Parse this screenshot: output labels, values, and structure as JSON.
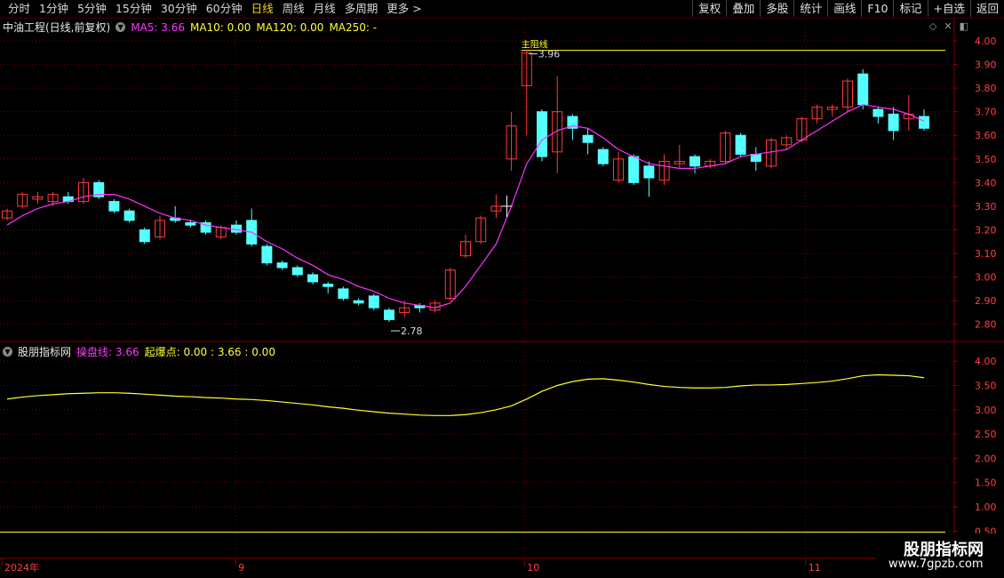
{
  "toolbar": {
    "periods": [
      "分时",
      "1分钟",
      "5分钟",
      "15分钟",
      "30分钟",
      "60分钟",
      "日线",
      "周线",
      "月线",
      "多周期",
      "更多 >"
    ],
    "active_period": "日线",
    "actions": [
      "复权",
      "叠加",
      "多股",
      "统计",
      "画线",
      "F10",
      "标记",
      "+自选",
      "返回"
    ]
  },
  "main_panel": {
    "stock_title": "中油工程(日线,前复权)",
    "ma5_label": "MA5: 3.66",
    "ma10_label": "MA10: 0.00",
    "ma120_label": "MA120: 0.00",
    "ma250_label": "MA250: -",
    "high_annotation": "3.96",
    "low_annotation": "2.78",
    "resistance_label": "主阻线",
    "y_ticks": [
      "4.00",
      "3.90",
      "3.80",
      "3.70",
      "3.60",
      "3.50",
      "3.40",
      "3.30",
      "3.20",
      "3.10",
      "3.00",
      "2.90",
      "2.80"
    ]
  },
  "indicator_panel": {
    "name": "股朋指标网",
    "line1_label": "操盘线: 3.66",
    "line2_label": "起爆点: 0.00 : 3.66 : 0.00",
    "y_ticks": [
      "4.00",
      "3.50",
      "3.00",
      "2.50",
      "2.00",
      "1.50",
      "1.00",
      "0.50"
    ]
  },
  "x_axis": {
    "labels": [
      "2024年",
      "9",
      "10",
      "11"
    ]
  },
  "colors": {
    "up": "#ff3b3b",
    "down": "#54ffff",
    "ma5": "#ff33ff",
    "indicator": "#ffff33",
    "grid": "#7a0000",
    "axis_text": "#ff4040"
  },
  "watermark": {
    "title": "股朋指标网",
    "url": "www.7gpzb.com"
  },
  "chart_data": {
    "type": "candlestick",
    "title": "中油工程(日线,前复权)",
    "ylim": [
      2.75,
      4.03
    ],
    "candles": [
      [
        3.25,
        3.29,
        3.24,
        3.28
      ],
      [
        3.3,
        3.36,
        3.29,
        3.35
      ],
      [
        3.33,
        3.36,
        3.31,
        3.34
      ],
      [
        3.32,
        3.36,
        3.3,
        3.35
      ],
      [
        3.34,
        3.36,
        3.31,
        3.32
      ],
      [
        3.32,
        3.42,
        3.31,
        3.4
      ],
      [
        3.4,
        3.41,
        3.33,
        3.34
      ],
      [
        3.32,
        3.33,
        3.27,
        3.28
      ],
      [
        3.28,
        3.29,
        3.23,
        3.24
      ],
      [
        3.2,
        3.21,
        3.14,
        3.15
      ],
      [
        3.17,
        3.26,
        3.16,
        3.24
      ],
      [
        3.25,
        3.3,
        3.23,
        3.24
      ],
      [
        3.23,
        3.24,
        3.21,
        3.22
      ],
      [
        3.23,
        3.24,
        3.18,
        3.19
      ],
      [
        3.17,
        3.22,
        3.16,
        3.21
      ],
      [
        3.22,
        3.24,
        3.18,
        3.19
      ],
      [
        3.24,
        3.29,
        3.13,
        3.14
      ],
      [
        3.13,
        3.14,
        3.05,
        3.06
      ],
      [
        3.06,
        3.07,
        3.03,
        3.04
      ],
      [
        3.04,
        3.05,
        3.0,
        3.01
      ],
      [
        3.01,
        3.02,
        2.97,
        2.98
      ],
      [
        2.97,
        2.98,
        2.93,
        2.96
      ],
      [
        2.95,
        2.96,
        2.9,
        2.91
      ],
      [
        2.9,
        2.91,
        2.88,
        2.89
      ],
      [
        2.92,
        2.93,
        2.86,
        2.87
      ],
      [
        2.86,
        2.87,
        2.81,
        2.82
      ],
      [
        2.85,
        2.9,
        2.83,
        2.87
      ],
      [
        2.88,
        2.89,
        2.85,
        2.87
      ],
      [
        2.86,
        2.9,
        2.85,
        2.89
      ],
      [
        2.91,
        3.04,
        2.9,
        3.03
      ],
      [
        3.09,
        3.18,
        3.08,
        3.15
      ],
      [
        3.15,
        3.26,
        3.14,
        3.25
      ],
      [
        3.28,
        3.35,
        3.25,
        3.3
      ],
      [
        3.5,
        3.7,
        3.45,
        3.64
      ],
      [
        3.81,
        3.96,
        3.6,
        3.95
      ],
      [
        3.7,
        3.71,
        3.49,
        3.51
      ],
      [
        3.53,
        3.85,
        3.44,
        3.7
      ],
      [
        3.68,
        3.69,
        3.58,
        3.63
      ],
      [
        3.6,
        3.63,
        3.52,
        3.57
      ],
      [
        3.54,
        3.55,
        3.47,
        3.48
      ],
      [
        3.41,
        3.53,
        3.4,
        3.5
      ],
      [
        3.51,
        3.52,
        3.39,
        3.4
      ],
      [
        3.47,
        3.49,
        3.34,
        3.42
      ],
      [
        3.41,
        3.52,
        3.39,
        3.49
      ],
      [
        3.48,
        3.56,
        3.46,
        3.49
      ],
      [
        3.51,
        3.52,
        3.44,
        3.47
      ],
      [
        3.47,
        3.5,
        3.46,
        3.49
      ],
      [
        3.49,
        3.62,
        3.48,
        3.61
      ],
      [
        3.6,
        3.61,
        3.51,
        3.52
      ],
      [
        3.52,
        3.55,
        3.45,
        3.49
      ],
      [
        3.47,
        3.59,
        3.46,
        3.58
      ],
      [
        3.56,
        3.6,
        3.54,
        3.59
      ],
      [
        3.58,
        3.68,
        3.57,
        3.67
      ],
      [
        3.67,
        3.73,
        3.65,
        3.72
      ],
      [
        3.71,
        3.73,
        3.68,
        3.72
      ],
      [
        3.72,
        3.84,
        3.7,
        3.83
      ],
      [
        3.86,
        3.88,
        3.71,
        3.73
      ],
      [
        3.71,
        3.72,
        3.65,
        3.68
      ],
      [
        3.69,
        3.72,
        3.58,
        3.62
      ],
      [
        3.67,
        3.77,
        3.62,
        3.69
      ],
      [
        3.68,
        3.71,
        3.62,
        3.63
      ]
    ],
    "ma5": [
      3.22,
      3.26,
      3.29,
      3.31,
      3.32,
      3.34,
      3.35,
      3.35,
      3.33,
      3.3,
      3.27,
      3.25,
      3.24,
      3.22,
      3.21,
      3.2,
      3.19,
      3.15,
      3.12,
      3.08,
      3.05,
      3.01,
      2.99,
      2.96,
      2.94,
      2.91,
      2.89,
      2.88,
      2.87,
      2.89,
      2.96,
      3.05,
      3.14,
      3.3,
      3.48,
      3.58,
      3.62,
      3.64,
      3.63,
      3.59,
      3.54,
      3.51,
      3.48,
      3.47,
      3.46,
      3.46,
      3.47,
      3.48,
      3.51,
      3.52,
      3.53,
      3.54,
      3.58,
      3.62,
      3.66,
      3.7,
      3.73,
      3.72,
      3.71,
      3.69,
      3.66
    ],
    "indicator_line": [
      3.22,
      3.26,
      3.29,
      3.31,
      3.33,
      3.34,
      3.35,
      3.35,
      3.34,
      3.32,
      3.3,
      3.28,
      3.27,
      3.25,
      3.24,
      3.22,
      3.21,
      3.19,
      3.16,
      3.13,
      3.1,
      3.06,
      3.03,
      2.99,
      2.96,
      2.93,
      2.91,
      2.89,
      2.88,
      2.88,
      2.9,
      2.94,
      3.0,
      3.08,
      3.22,
      3.38,
      3.5,
      3.58,
      3.63,
      3.64,
      3.61,
      3.57,
      3.52,
      3.48,
      3.46,
      3.45,
      3.45,
      3.46,
      3.49,
      3.51,
      3.51,
      3.52,
      3.54,
      3.56,
      3.59,
      3.64,
      3.7,
      3.72,
      3.71,
      3.7,
      3.66
    ],
    "indicator_ylim": [
      0.45,
      4.15
    ]
  }
}
